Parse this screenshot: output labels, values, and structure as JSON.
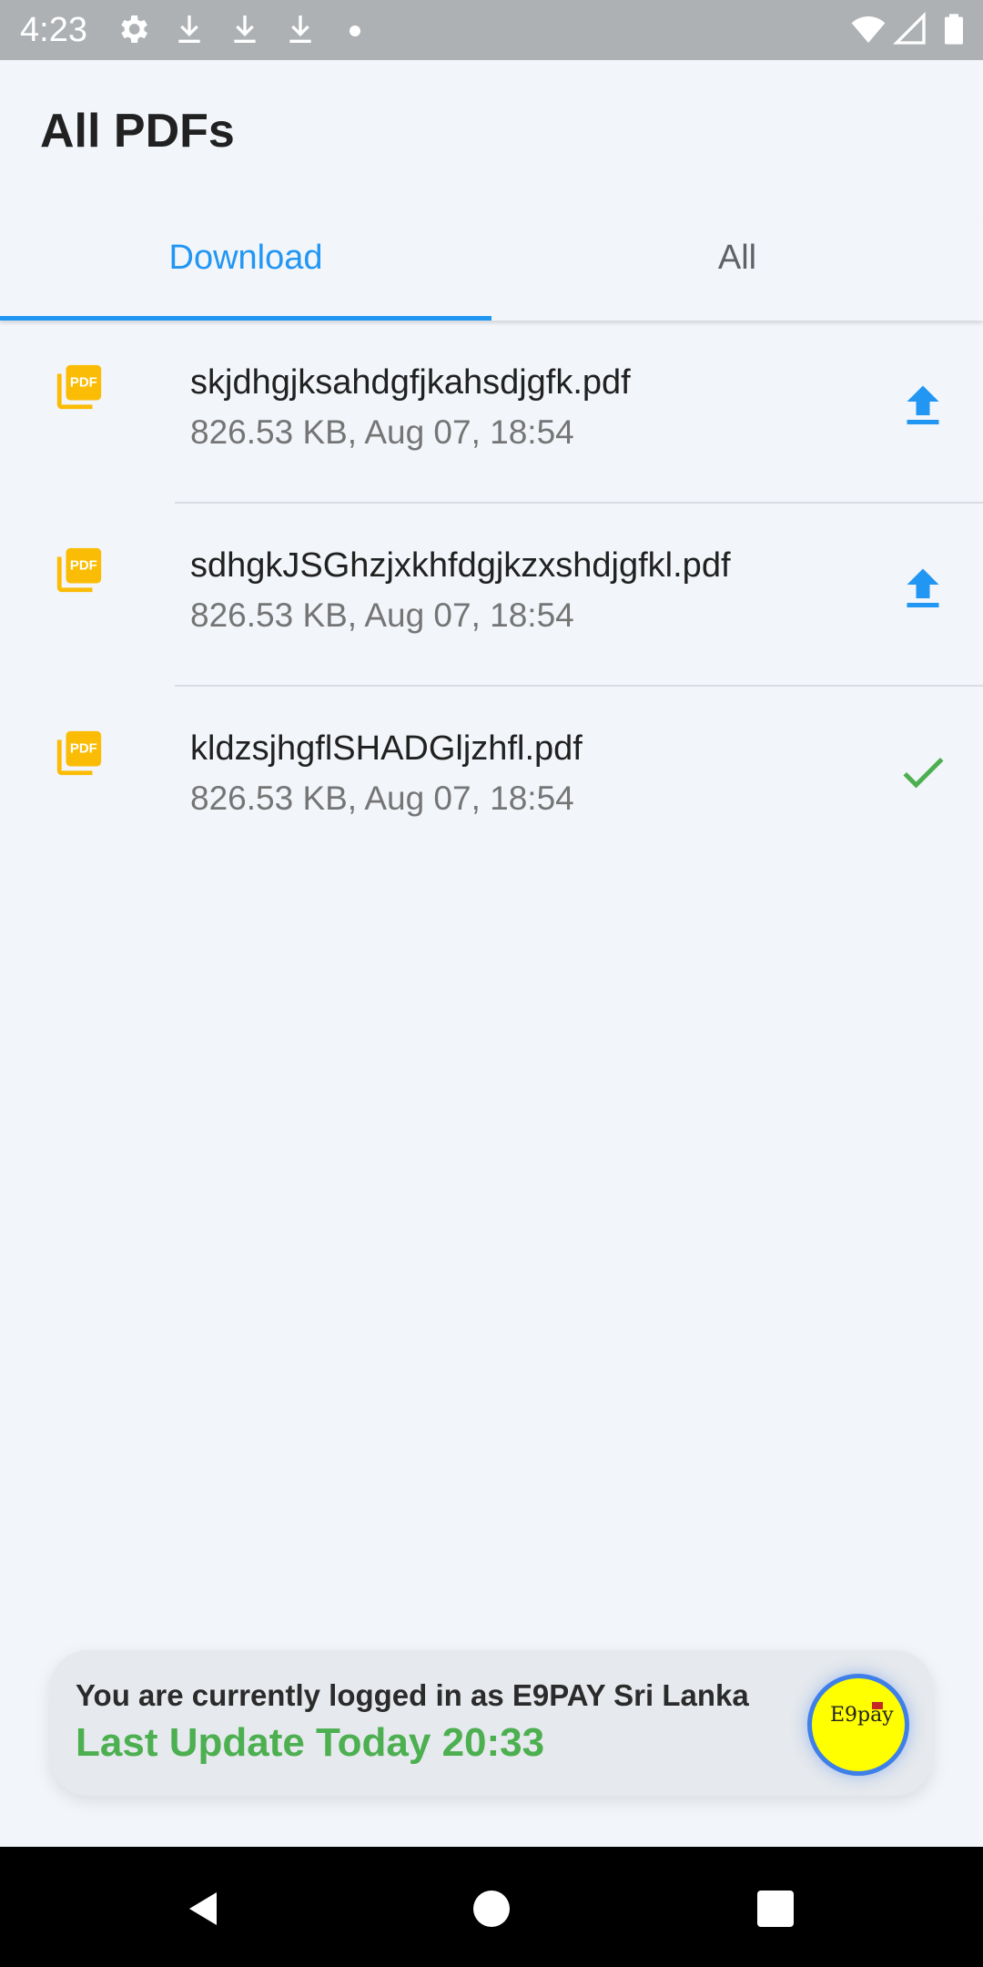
{
  "status_bar": {
    "time": "4:23",
    "icons": [
      "settings-icon",
      "download-icon",
      "download-icon",
      "download-icon",
      "dot-icon",
      "wifi-icon",
      "signal-icon",
      "battery-icon"
    ]
  },
  "app_bar": {
    "title": "All PDFs"
  },
  "tabs": [
    {
      "label": "Download",
      "active": true
    },
    {
      "label": "All",
      "active": false
    }
  ],
  "files": [
    {
      "name": "skjdhgjksahdgfjkahsdjgfk.pdf",
      "meta": "826.53 KB, Aug 07, 18:54",
      "action": "upload-icon"
    },
    {
      "name": "sdhgkJSGhzjxkhfdgjkzxshdjgfkl.pdf",
      "meta": "826.53 KB, Aug 07, 18:54",
      "action": "upload-icon"
    },
    {
      "name": "kldzsjhgflSHADGljzhfl.pdf",
      "meta": "826.53 KB, Aug 07, 18:54",
      "action": "check-icon"
    }
  ],
  "card": {
    "login_text": "You are currently logged in as E9PAY Sri Lanka",
    "update_text": "Last Update Today 20:33",
    "logo_text": "E9pay"
  },
  "colors": {
    "accent": "#2196f3",
    "pdf_icon": "#fbbc05",
    "success": "#4caf50",
    "status_bar": "#aeb1b4",
    "background": "#f2f5fa"
  }
}
